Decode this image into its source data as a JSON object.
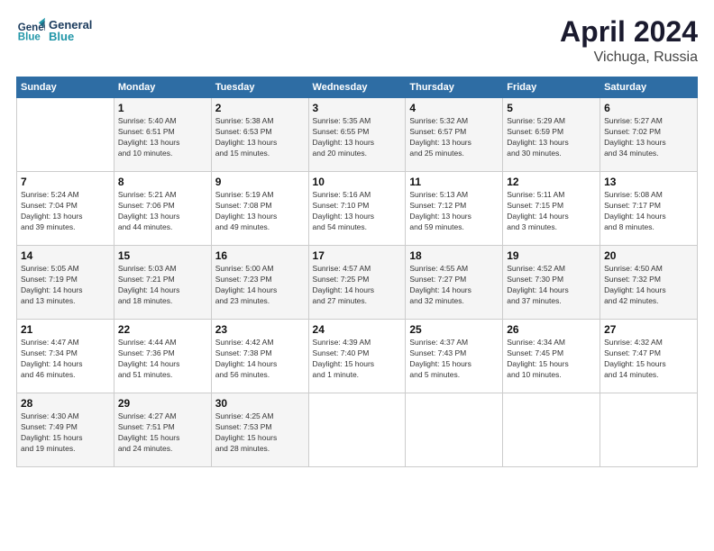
{
  "header": {
    "logo_line1": "General",
    "logo_line2": "Blue",
    "month_year": "April 2024",
    "location": "Vichuga, Russia"
  },
  "weekdays": [
    "Sunday",
    "Monday",
    "Tuesday",
    "Wednesday",
    "Thursday",
    "Friday",
    "Saturday"
  ],
  "weeks": [
    [
      {
        "day": "",
        "text": ""
      },
      {
        "day": "1",
        "text": "Sunrise: 5:40 AM\nSunset: 6:51 PM\nDaylight: 13 hours\nand 10 minutes."
      },
      {
        "day": "2",
        "text": "Sunrise: 5:38 AM\nSunset: 6:53 PM\nDaylight: 13 hours\nand 15 minutes."
      },
      {
        "day": "3",
        "text": "Sunrise: 5:35 AM\nSunset: 6:55 PM\nDaylight: 13 hours\nand 20 minutes."
      },
      {
        "day": "4",
        "text": "Sunrise: 5:32 AM\nSunset: 6:57 PM\nDaylight: 13 hours\nand 25 minutes."
      },
      {
        "day": "5",
        "text": "Sunrise: 5:29 AM\nSunset: 6:59 PM\nDaylight: 13 hours\nand 30 minutes."
      },
      {
        "day": "6",
        "text": "Sunrise: 5:27 AM\nSunset: 7:02 PM\nDaylight: 13 hours\nand 34 minutes."
      }
    ],
    [
      {
        "day": "7",
        "text": "Sunrise: 5:24 AM\nSunset: 7:04 PM\nDaylight: 13 hours\nand 39 minutes."
      },
      {
        "day": "8",
        "text": "Sunrise: 5:21 AM\nSunset: 7:06 PM\nDaylight: 13 hours\nand 44 minutes."
      },
      {
        "day": "9",
        "text": "Sunrise: 5:19 AM\nSunset: 7:08 PM\nDaylight: 13 hours\nand 49 minutes."
      },
      {
        "day": "10",
        "text": "Sunrise: 5:16 AM\nSunset: 7:10 PM\nDaylight: 13 hours\nand 54 minutes."
      },
      {
        "day": "11",
        "text": "Sunrise: 5:13 AM\nSunset: 7:12 PM\nDaylight: 13 hours\nand 59 minutes."
      },
      {
        "day": "12",
        "text": "Sunrise: 5:11 AM\nSunset: 7:15 PM\nDaylight: 14 hours\nand 3 minutes."
      },
      {
        "day": "13",
        "text": "Sunrise: 5:08 AM\nSunset: 7:17 PM\nDaylight: 14 hours\nand 8 minutes."
      }
    ],
    [
      {
        "day": "14",
        "text": "Sunrise: 5:05 AM\nSunset: 7:19 PM\nDaylight: 14 hours\nand 13 minutes."
      },
      {
        "day": "15",
        "text": "Sunrise: 5:03 AM\nSunset: 7:21 PM\nDaylight: 14 hours\nand 18 minutes."
      },
      {
        "day": "16",
        "text": "Sunrise: 5:00 AM\nSunset: 7:23 PM\nDaylight: 14 hours\nand 23 minutes."
      },
      {
        "day": "17",
        "text": "Sunrise: 4:57 AM\nSunset: 7:25 PM\nDaylight: 14 hours\nand 27 minutes."
      },
      {
        "day": "18",
        "text": "Sunrise: 4:55 AM\nSunset: 7:27 PM\nDaylight: 14 hours\nand 32 minutes."
      },
      {
        "day": "19",
        "text": "Sunrise: 4:52 AM\nSunset: 7:30 PM\nDaylight: 14 hours\nand 37 minutes."
      },
      {
        "day": "20",
        "text": "Sunrise: 4:50 AM\nSunset: 7:32 PM\nDaylight: 14 hours\nand 42 minutes."
      }
    ],
    [
      {
        "day": "21",
        "text": "Sunrise: 4:47 AM\nSunset: 7:34 PM\nDaylight: 14 hours\nand 46 minutes."
      },
      {
        "day": "22",
        "text": "Sunrise: 4:44 AM\nSunset: 7:36 PM\nDaylight: 14 hours\nand 51 minutes."
      },
      {
        "day": "23",
        "text": "Sunrise: 4:42 AM\nSunset: 7:38 PM\nDaylight: 14 hours\nand 56 minutes."
      },
      {
        "day": "24",
        "text": "Sunrise: 4:39 AM\nSunset: 7:40 PM\nDaylight: 15 hours\nand 1 minute."
      },
      {
        "day": "25",
        "text": "Sunrise: 4:37 AM\nSunset: 7:43 PM\nDaylight: 15 hours\nand 5 minutes."
      },
      {
        "day": "26",
        "text": "Sunrise: 4:34 AM\nSunset: 7:45 PM\nDaylight: 15 hours\nand 10 minutes."
      },
      {
        "day": "27",
        "text": "Sunrise: 4:32 AM\nSunset: 7:47 PM\nDaylight: 15 hours\nand 14 minutes."
      }
    ],
    [
      {
        "day": "28",
        "text": "Sunrise: 4:30 AM\nSunset: 7:49 PM\nDaylight: 15 hours\nand 19 minutes."
      },
      {
        "day": "29",
        "text": "Sunrise: 4:27 AM\nSunset: 7:51 PM\nDaylight: 15 hours\nand 24 minutes."
      },
      {
        "day": "30",
        "text": "Sunrise: 4:25 AM\nSunset: 7:53 PM\nDaylight: 15 hours\nand 28 minutes."
      },
      {
        "day": "",
        "text": ""
      },
      {
        "day": "",
        "text": ""
      },
      {
        "day": "",
        "text": ""
      },
      {
        "day": "",
        "text": ""
      }
    ]
  ]
}
